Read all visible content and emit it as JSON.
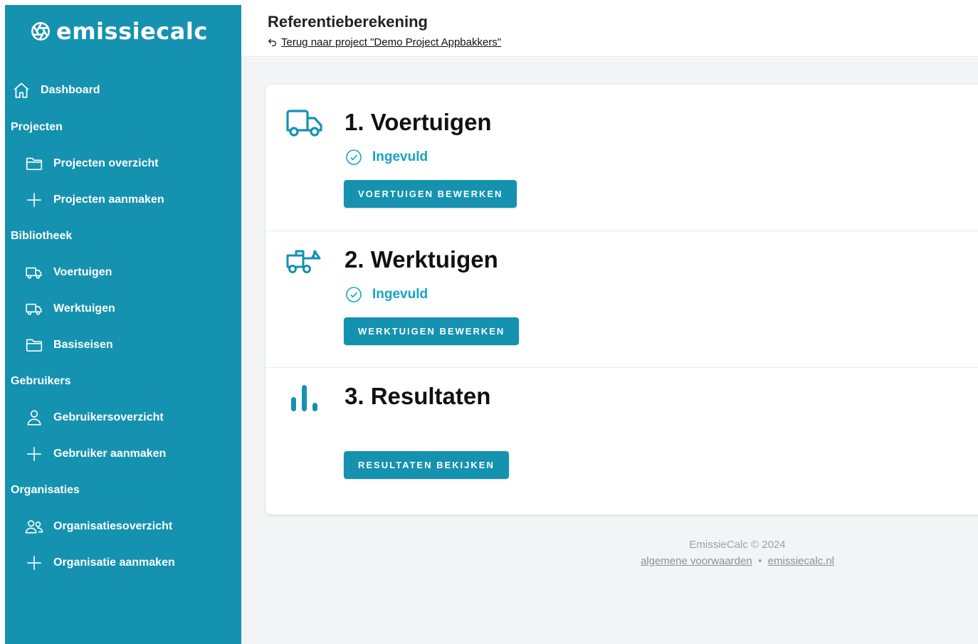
{
  "brand": {
    "name": "emissiecalc",
    "logo_icon": "aperture-icon",
    "accent": "#1592b0",
    "status_color": "#17a3c5"
  },
  "sidebar": {
    "dashboard": {
      "label": "Dashboard",
      "icon": "home-icon"
    },
    "sections": [
      {
        "label": "Projecten",
        "items": [
          {
            "label": "Projecten overzicht",
            "icon": "folder-icon"
          },
          {
            "label": "Projecten aanmaken",
            "icon": "plus-icon"
          }
        ]
      },
      {
        "label": "Bibliotheek",
        "items": [
          {
            "label": "Voertuigen",
            "icon": "truck-icon"
          },
          {
            "label": "Werktuigen",
            "icon": "truck-icon"
          },
          {
            "label": "Basiseisen",
            "icon": "folder-icon"
          }
        ]
      },
      {
        "label": "Gebruikers",
        "items": [
          {
            "label": "Gebruikersoverzicht",
            "icon": "user-icon"
          },
          {
            "label": "Gebruiker aanmaken",
            "icon": "plus-icon"
          }
        ]
      },
      {
        "label": "Organisaties",
        "items": [
          {
            "label": "Organisatiesoverzicht",
            "icon": "users-icon"
          },
          {
            "label": "Organisatie aanmaken",
            "icon": "plus-icon"
          }
        ]
      }
    ]
  },
  "header": {
    "title": "Referentieberekening",
    "back_link": "Terug naar project \"Demo Project Appbakkers\""
  },
  "steps": [
    {
      "title": "1. Voertuigen",
      "status": "Ingevuld",
      "button": "VOERTUIGEN BEWERKEN",
      "icon": "truck-icon"
    },
    {
      "title": "2. Werktuigen",
      "status": "Ingevuld",
      "button": "WERKTUIGEN BEWERKEN",
      "icon": "excavator-icon"
    },
    {
      "title": "3. Resultaten",
      "button": "RESULTATEN BEKIJKEN",
      "icon": "bar-chart-icon"
    }
  ],
  "footer": {
    "copyright": "EmissieCalc © 2024",
    "link_terms": "algemene voorwaarden",
    "separator": "•",
    "link_site": "emissiecalc.nl"
  }
}
